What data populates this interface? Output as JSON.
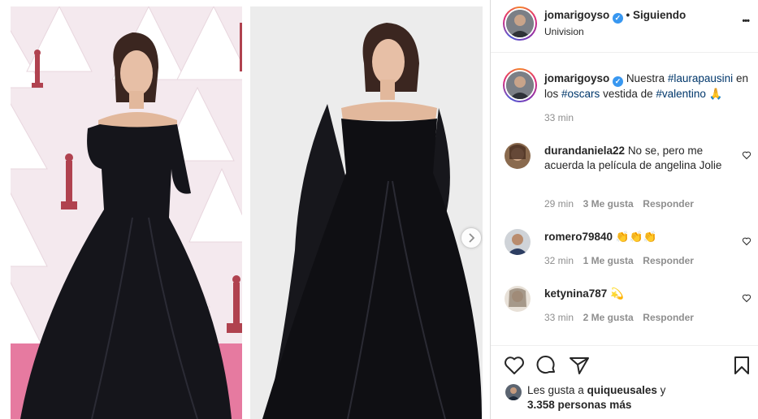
{
  "post": {
    "author": "jomarigoyso",
    "following_label": "• Siguiendo",
    "location": "Univision",
    "more_label": "•••"
  },
  "caption": {
    "author": "jomarigoyso",
    "text_1": "Nuestra",
    "hashtag_1": "#laurapausini",
    "text_2": "en los",
    "hashtag_2": "#oscars",
    "text_3": "vestida de",
    "hashtag_3": "#valentino",
    "emoji": "🙏",
    "time": "33 min"
  },
  "comments": [
    {
      "user": "durandaniela22",
      "text": "No se, pero me acuerda la película de angelina Jolie",
      "time": "29 min",
      "likes": "3 Me gusta",
      "reply": "Responder"
    },
    {
      "user": "romero79840",
      "text": "👏👏👏",
      "time": "32 min",
      "likes": "1 Me gusta",
      "reply": "Responder"
    },
    {
      "user": "ketynina787",
      "text": "💫",
      "time": "33 min",
      "likes": "2 Me gusta",
      "reply": "Responder"
    }
  ],
  "likes_summary": {
    "prefix": "Les gusta a",
    "user": "quiqueusales",
    "connector": "y",
    "count": "3.358 personas más"
  },
  "colors": {
    "verified": "#3897f0",
    "link": "#00376b",
    "muted": "#8e8e8e"
  }
}
